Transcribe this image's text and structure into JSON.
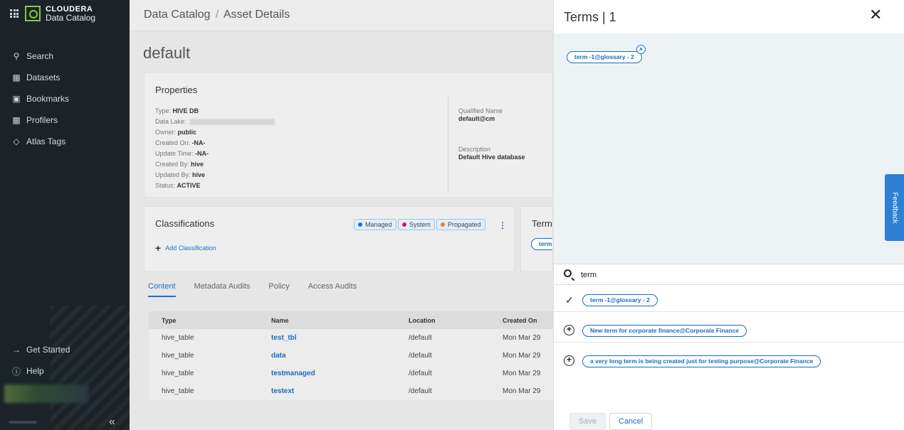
{
  "sidebar": {
    "brand_name": "CLOUDERA",
    "brand_sub": "Data Catalog",
    "items": [
      {
        "label": "Search",
        "icon": "search-icon"
      },
      {
        "label": "Datasets",
        "icon": "datasets-icon"
      },
      {
        "label": "Bookmarks",
        "icon": "bookmark-icon"
      },
      {
        "label": "Profilers",
        "icon": "profiler-icon"
      },
      {
        "label": "Atlas Tags",
        "icon": "tag-icon"
      }
    ],
    "bottom_items": [
      {
        "label": "Get Started",
        "icon": "arrow-right-icon"
      },
      {
        "label": "Help",
        "icon": "help-icon"
      }
    ]
  },
  "header": {
    "crumb_root": "Data Catalog",
    "crumb_sep": "/",
    "crumb_current": "Asset Details"
  },
  "asset": {
    "title": "default",
    "properties": {
      "heading": "Properties",
      "type_label": "Type:",
      "type_value": "HIVE DB",
      "lake_label": "Data Lake:",
      "owner_label": "Owner:",
      "owner_value": "public",
      "created_on_label": "Created On:",
      "created_on_value": "-NA-",
      "update_time_label": "Update Time:",
      "update_time_value": "-NA-",
      "created_by_label": "Created By:",
      "created_by_value": "hive",
      "updated_by_label": "Updated By:",
      "updated_by_value": "hive",
      "status_label": "Status:",
      "status_value": "ACTIVE",
      "qualified_label": "Qualified Name",
      "qualified_value": "default@cm",
      "desc_label": "Description",
      "desc_value": "Default Hive database"
    },
    "classifications": {
      "heading": "Classifications",
      "legend": [
        {
          "label": "Managed",
          "color": "#1a73c9"
        },
        {
          "label": "System",
          "color": "#c2177a"
        },
        {
          "label": "Propagated",
          "color": "#ee7d1d"
        }
      ],
      "add_label": "Add Classification"
    },
    "terms_card": {
      "heading": "Terms",
      "pill": "term"
    }
  },
  "tabs": [
    {
      "label": "Content",
      "active": true
    },
    {
      "label": "Metadata Audits",
      "active": false
    },
    {
      "label": "Policy",
      "active": false
    },
    {
      "label": "Access Audits",
      "active": false
    }
  ],
  "table": {
    "headers": [
      "Type",
      "Name",
      "Location",
      "Created On"
    ],
    "rows": [
      [
        "hive_table",
        "test_tbl",
        "/default",
        "Mon Mar 29"
      ],
      [
        "hive_table",
        "data",
        "/default",
        "Mon Mar 29"
      ],
      [
        "hive_table",
        "testmanaged",
        "/default",
        "Mon Mar 29"
      ],
      [
        "hive_table",
        "testext",
        "/default",
        "Mon Mar 29"
      ]
    ]
  },
  "panel": {
    "title": "Terms | 1",
    "selected": [
      "term -1@glossary - 2"
    ],
    "search_value": "term",
    "results": [
      {
        "label": "term -1@glossary - 2",
        "selected": true
      },
      {
        "label": "New term for corporate finance@Corporate Finance",
        "selected": false
      },
      {
        "label": "a very long term is being created just for testing purpose@Corporate Finance",
        "selected": false
      }
    ],
    "save_label": "Save",
    "cancel_label": "Cancel"
  },
  "feedback_label": "Feedback"
}
